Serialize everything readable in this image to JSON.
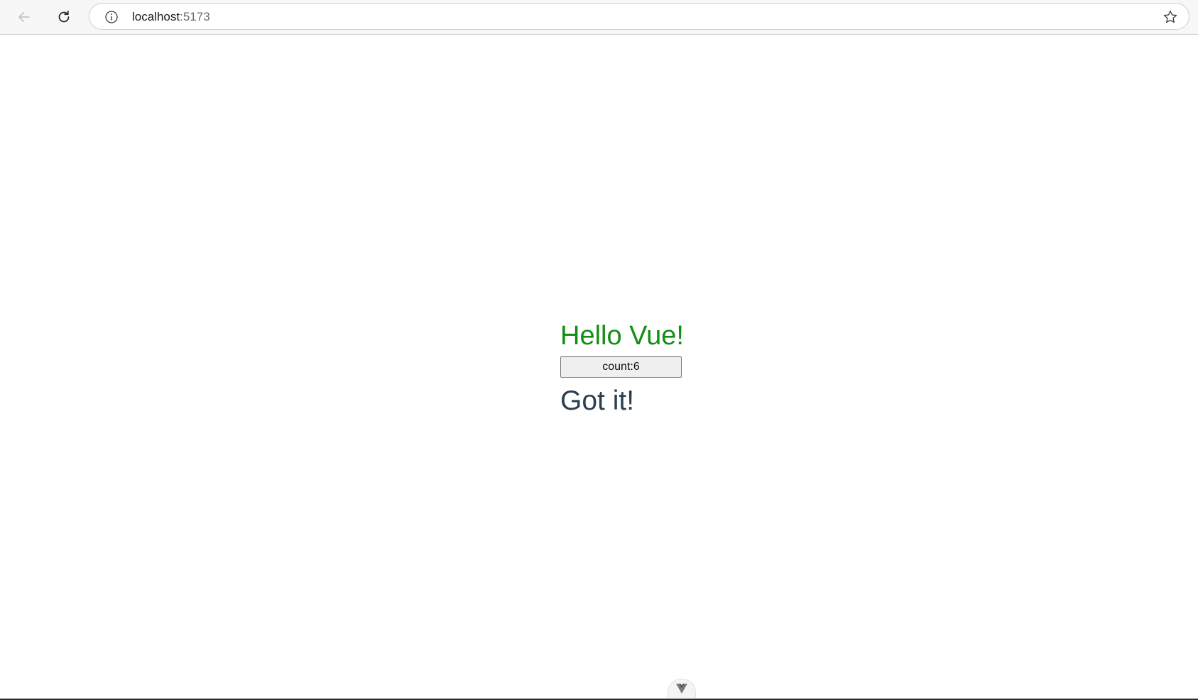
{
  "browser": {
    "url_host": "localhost",
    "url_port": ":5173",
    "icons": {
      "back": "back-arrow-icon",
      "reload": "reload-icon",
      "site_info": "info-icon",
      "bookmark": "star-icon",
      "devtools": "vue-logo-icon"
    }
  },
  "app": {
    "greeting": "Hello Vue!",
    "counter_label": "count:6",
    "message": "Got it!",
    "colors": {
      "greeting": "#138d13",
      "message": "#2c3e50"
    }
  }
}
